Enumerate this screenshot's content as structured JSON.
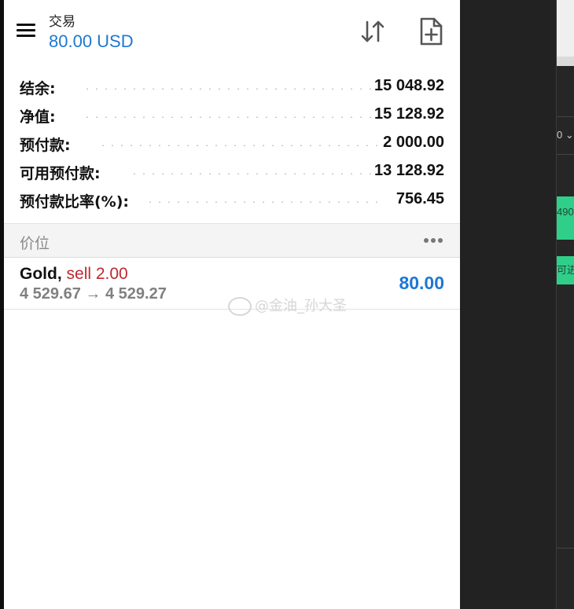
{
  "header": {
    "title": "交易",
    "balance_display": "80.00 USD"
  },
  "summary": [
    {
      "label": "结余:",
      "value": "15 048.92"
    },
    {
      "label": "净值:",
      "value": "15 128.92"
    },
    {
      "label": "预付款:",
      "value": "2 000.00"
    },
    {
      "label": "可用预付款:",
      "value": "13 128.92"
    },
    {
      "label": "预付款比率(%):",
      "value": "756.45"
    }
  ],
  "section": {
    "title": "价位"
  },
  "position": {
    "symbol": "Gold,",
    "side": "sell 2.00",
    "prices": "4 529.67 → 4 529.27",
    "profit": "80.00"
  },
  "watermark": "@金油_孙大圣",
  "background_app": {
    "price_fragment": "490",
    "button_fragment": "可进",
    "dropdown_fragment": "0 ⌄"
  },
  "icons": [
    "menu-icon",
    "sort-arrows-icon",
    "new-document-icon",
    "more-dots-icon",
    "weibo-icon"
  ],
  "colors": {
    "accent": "#1e78d2",
    "sell": "#c0282d",
    "green": "#2fcf8a"
  }
}
